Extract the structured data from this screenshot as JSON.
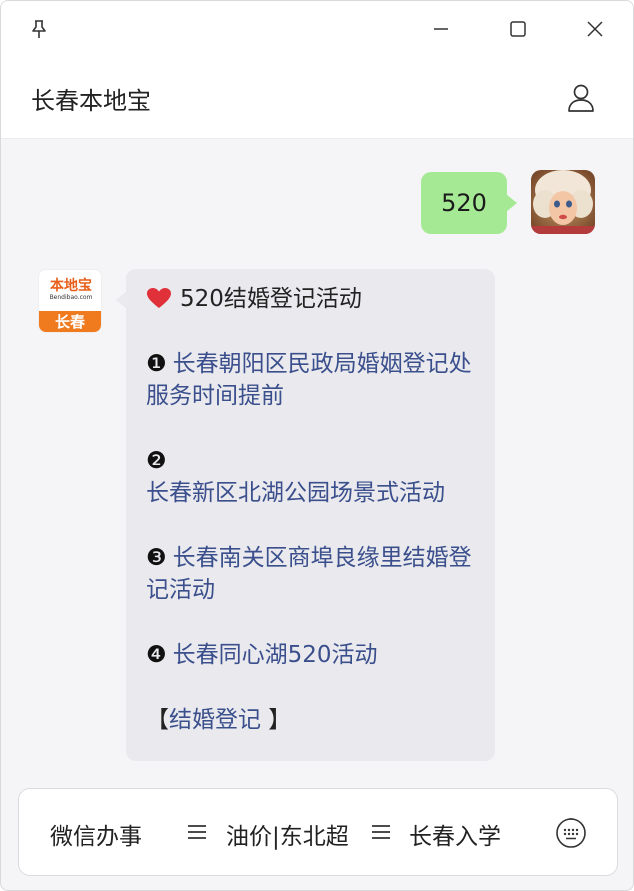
{
  "window": {
    "controls": {
      "pin_icon": "pin-icon",
      "minimize_icon": "minimize-icon",
      "maximize_icon": "maximize-icon",
      "close_icon": "close-icon"
    }
  },
  "header": {
    "title": "长春本地宝",
    "profile_icon": "user-profile-icon"
  },
  "chat": {
    "user_message": {
      "text": "520",
      "avatar": "user-avatar"
    },
    "bot_message": {
      "avatar": {
        "logo_text": "本地宝",
        "logo_sub": "Bendibao.com",
        "logo_city": "长春"
      },
      "title": "520结婚登记活动",
      "items": [
        {
          "num": "❶",
          "text": "长春朝阳区民政局婚姻登记处服务时间提前"
        },
        {
          "num": "❷",
          "text": "长春新区北湖公园场景式活动"
        },
        {
          "num": "❸",
          "text": "长春南关区商埠良缘里结婚登记活动"
        },
        {
          "num": "❹",
          "text": "长春同心湖520活动"
        }
      ],
      "footer_open": "【",
      "footer_link": "结婚登记",
      "footer_close": " 】",
      "colors": {
        "link": "#3a4f8c",
        "user_bubble": "#a6e995",
        "bot_bubble": "#e9e9ee"
      }
    }
  },
  "bottom_menu": {
    "items": [
      {
        "label": "微信办事"
      },
      {
        "label": "油价|东北超"
      },
      {
        "label": "长春入学"
      }
    ],
    "menu_icon": "menu-lines-icon",
    "keyboard_icon": "keyboard-icon"
  }
}
